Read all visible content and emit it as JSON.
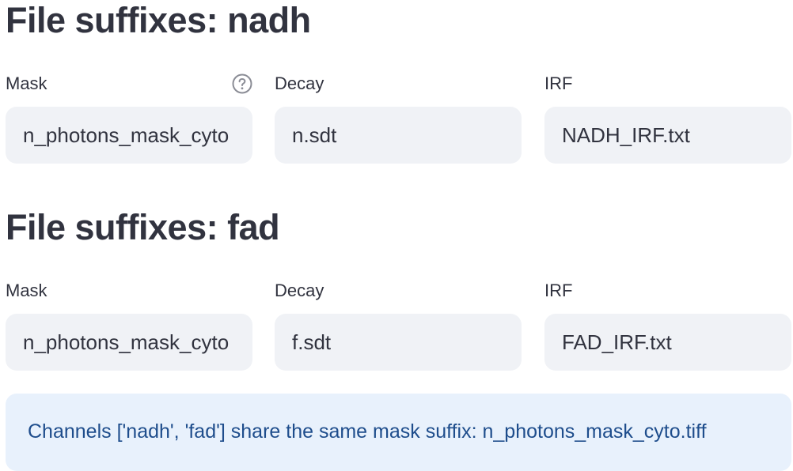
{
  "sections": [
    {
      "title": "File suffixes: nadh",
      "fields": [
        {
          "label": "Mask",
          "value": "n_photons_mask_cyto",
          "has_help": true
        },
        {
          "label": "Decay",
          "value": "n.sdt"
        },
        {
          "label": "IRF",
          "value": "NADH_IRF.txt"
        }
      ]
    },
    {
      "title": "File suffixes: fad",
      "fields": [
        {
          "label": "Mask",
          "value": "n_photons_mask_cyto"
        },
        {
          "label": "Decay",
          "value": "f.sdt"
        },
        {
          "label": "IRF",
          "value": "FAD_IRF.txt"
        }
      ]
    }
  ],
  "info": {
    "message": "Channels ['nadh', 'fad'] share the same mask suffix: n_photons_mask_cyto.tiff"
  },
  "icons": {
    "help": "question-circle-icon"
  },
  "colors": {
    "text": "#31333f",
    "input_bg": "#f0f2f6",
    "info_bg": "#e8f1fc",
    "info_text": "#1e4d8c",
    "help_icon": "#8b8d96"
  }
}
